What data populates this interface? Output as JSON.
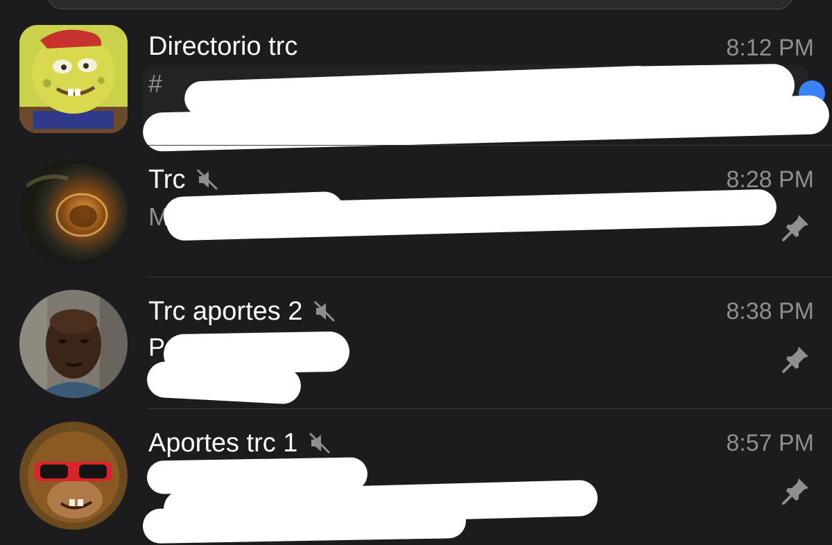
{
  "chats": [
    {
      "title": "Directorio trc",
      "time": "8:12 PM",
      "muted": false,
      "pinned": false,
      "unread": true,
      "preview_prefix": "#",
      "avatar_icon": "sponge-cartoon-avatar"
    },
    {
      "title": "Trc",
      "time": "8:28 PM",
      "muted": true,
      "pinned": true,
      "unread": false,
      "preview_prefix": "M",
      "avatar_icon": "planet-avatar"
    },
    {
      "title": "Trc aportes 2",
      "time": "8:38 PM",
      "muted": true,
      "pinned": true,
      "unread": false,
      "preview_prefix": "P",
      "avatar_icon": "man-face-avatar"
    },
    {
      "title": "Aportes trc 1",
      "time": "8:57 PM",
      "muted": true,
      "pinned": true,
      "unread": false,
      "preview_prefix": "",
      "avatar_icon": "monkey-sunglasses-avatar"
    }
  ],
  "colors": {
    "background": "#1c1c1e",
    "secondary_text": "#8e8e93",
    "unread_badge": "#3a82f7",
    "redaction": "#ffffff"
  }
}
